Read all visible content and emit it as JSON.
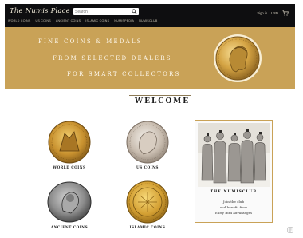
{
  "header": {
    "logo_text": "The Numis Place",
    "search": {
      "placeholder": "Search"
    },
    "nav": [
      "WORLD COINS",
      "US COINS",
      "ANCIENT COINS",
      "ISLAMIC COINS",
      "NUMISPEDIA",
      "NUMISCLUB"
    ],
    "util": {
      "signin": "Sign in",
      "usd": "USD"
    }
  },
  "banner": {
    "line1": "FINE COINS & MEDALS",
    "line2": "FROM SELECTED DEALERS",
    "line3": "FOR SMART COLLECTORS",
    "color": "#c9a257"
  },
  "welcome": {
    "title": "WELCOME"
  },
  "categories": [
    {
      "label": "WORLD COINS",
      "icon": "world-coin-icon"
    },
    {
      "label": "US COINS",
      "icon": "us-coin-icon"
    },
    {
      "label": "ANCIENT COINS",
      "icon": "ancient-coin-icon"
    },
    {
      "label": "ISLAMIC COINS",
      "icon": "islamic-coin-icon"
    }
  ],
  "numisclub": {
    "title": "THE NUMISCLUB",
    "line1": "Join the club",
    "line2": "and benefit from",
    "line3": "Early Bird advantages"
  },
  "colors": {
    "topbar": "#0e0e10",
    "gold": "#c9a257",
    "border": "#c9a257"
  }
}
